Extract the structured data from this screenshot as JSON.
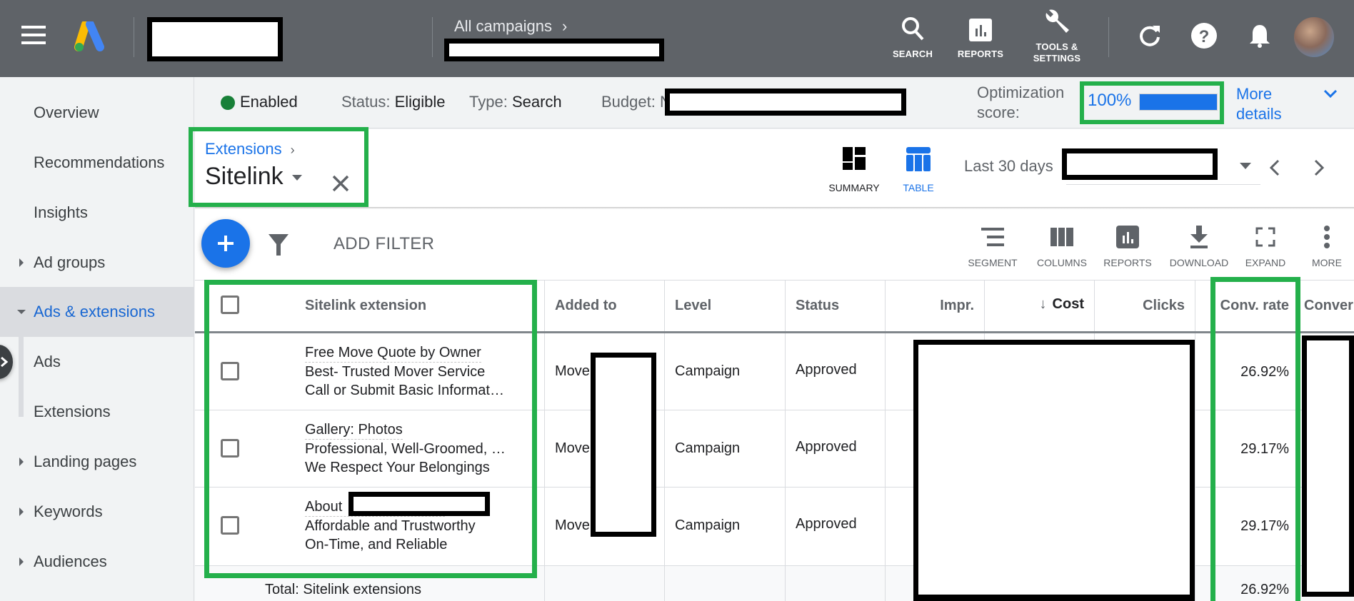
{
  "topbar": {
    "breadcrumb_parent": "All campaigns",
    "tools": [
      {
        "label": "SEARCH",
        "icon": "search-icon"
      },
      {
        "label": "REPORTS",
        "icon": "reports-icon"
      },
      {
        "label_line1": "TOOLS &",
        "label_line2": "SETTINGS",
        "icon": "wrench-icon"
      }
    ],
    "icons": [
      "refresh-icon",
      "help-icon",
      "bell-icon",
      "avatar"
    ]
  },
  "sidebar": {
    "items": [
      {
        "label": "Overview",
        "expandable": false
      },
      {
        "label": "Recommendations",
        "expandable": false
      },
      {
        "label": "Insights",
        "expandable": false
      },
      {
        "label": "Ad groups",
        "expandable": true
      },
      {
        "label": "Ads & extensions",
        "expandable": true,
        "expanded": true,
        "active": true
      },
      {
        "label": "Ads",
        "sub": true
      },
      {
        "label": "Extensions",
        "sub": true
      },
      {
        "label": "Landing pages",
        "expandable": true
      },
      {
        "label": "Keywords",
        "expandable": true
      },
      {
        "label": "Audiences",
        "expandable": true
      }
    ]
  },
  "statusbar": {
    "enabled": "Enabled",
    "status_label": "Status:",
    "status_value": "Eligible",
    "type_label": "Type:",
    "type_value": "Search",
    "budget_label": "Budget: ",
    "budget_prefix": "N",
    "opt_label_1": "Optimization",
    "opt_label_2": "score:",
    "opt_value": "100%",
    "opt_fraction": 1.0,
    "more_1": "More",
    "more_2": "details",
    "colors": {
      "enabled_dot": "#188038",
      "accent": "#1a73e8"
    }
  },
  "page": {
    "breadcrumb": "Extensions",
    "title": "Sitelink",
    "views": [
      {
        "label": "SUMMARY",
        "active": false
      },
      {
        "label": "TABLE",
        "active": true
      }
    ],
    "date_range": "Last 30 days"
  },
  "toolbar": {
    "add_filter": "ADD FILTER",
    "actions": [
      {
        "label": "SEGMENT",
        "icon": "segment-icon"
      },
      {
        "label": "COLUMNS",
        "icon": "columns-icon"
      },
      {
        "label": "REPORTS",
        "icon": "reports-icon"
      },
      {
        "label": "DOWNLOAD",
        "icon": "download-icon"
      },
      {
        "label": "EXPAND",
        "icon": "expand-icon"
      },
      {
        "label": "MORE",
        "icon": "more-vert-icon"
      }
    ]
  },
  "table": {
    "columns": [
      "Sitelink extension",
      "Added to",
      "Level",
      "Status",
      "Impr.",
      "Cost",
      "Clicks",
      "Conv. rate",
      "Conver"
    ],
    "sort_column": "Cost",
    "rows": [
      {
        "title": "Free Move Quote by Owner",
        "desc1": "Best- Trusted Mover Service",
        "desc2": "Call or Submit Basic Informat…",
        "added_to": "Move",
        "level": "Campaign",
        "status": "Approved",
        "conv_rate": "26.92%"
      },
      {
        "title": "Gallery: Photos",
        "desc1": "Professional, Well-Groomed, …",
        "desc2": "We Respect Your Belongings",
        "added_to": "Move",
        "level": "Campaign",
        "status": "Approved",
        "conv_rate": "29.17%"
      },
      {
        "title": "About ",
        "desc1": "Affordable and Trustworthy",
        "desc2": "On-Time, and Reliable",
        "added_to": "Move",
        "level": "Campaign",
        "status": "Approved",
        "conv_rate": "29.17%"
      }
    ],
    "total": {
      "label": "Total: Sitelink extensions",
      "conv_rate": "26.92%"
    }
  }
}
